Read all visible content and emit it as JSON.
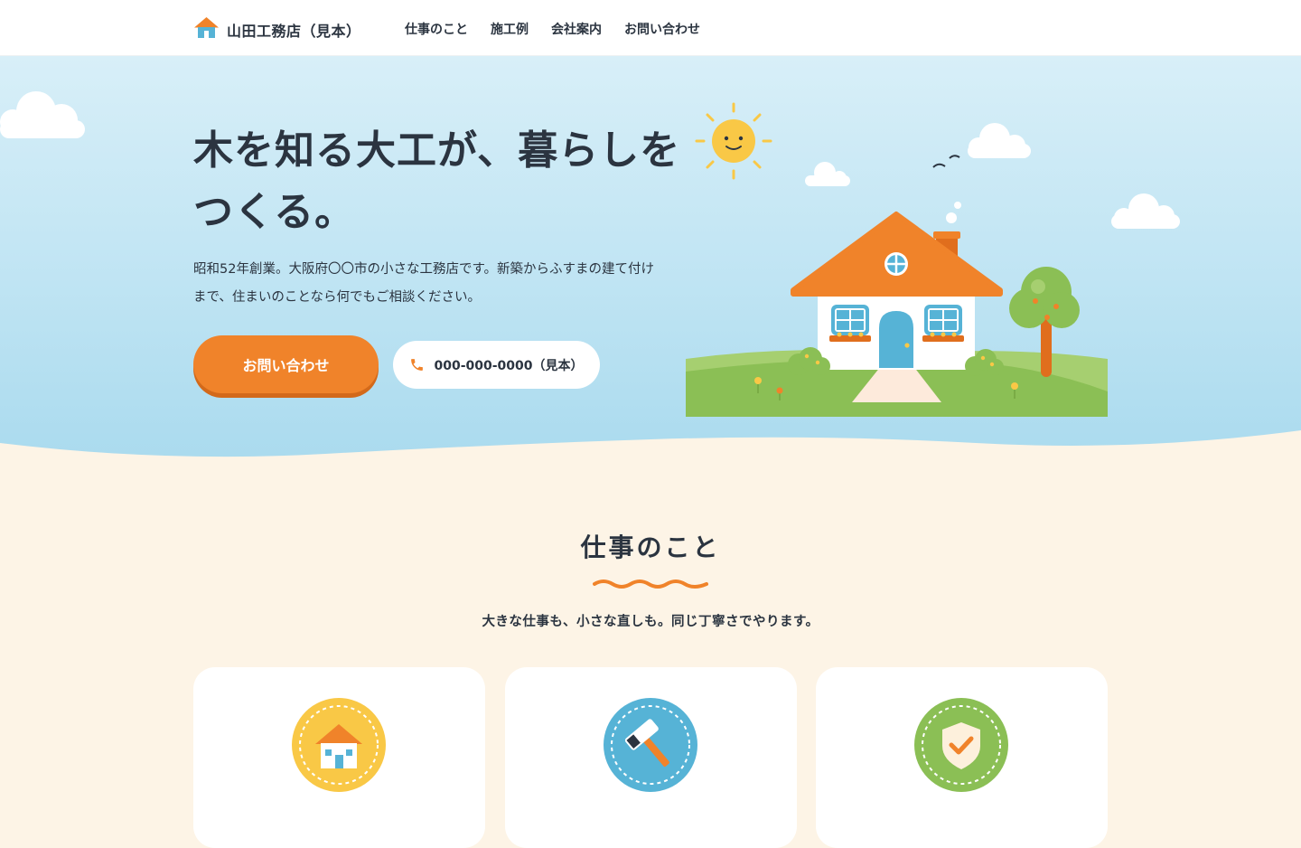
{
  "header": {
    "logo_text": "山田工務店（見本）",
    "logo_icon": "house-icon",
    "nav": [
      {
        "label": "仕事のこと"
      },
      {
        "label": "施工例"
      },
      {
        "label": "会社案内"
      },
      {
        "label": "お問い合わせ"
      }
    ]
  },
  "hero": {
    "title": "木を知る大工が、暮らしをつくる。",
    "description": "昭和52年創業。大阪府〇〇市の小さな工務店です。新築からふすまの建て付けまで、住まいのことなら何でもご相談ください。",
    "contact_button": "お問い合わせ",
    "phone_button": "000-000-0000（見本）",
    "phone_icon": "phone-icon"
  },
  "services": {
    "title": "仕事のこと",
    "lead": "大きな仕事も、小さな直しも。同じ丁寧さでやります。",
    "cards": [
      {
        "icon": "house-icon",
        "color": "#f9c846"
      },
      {
        "icon": "hammer-icon",
        "color": "#56b3d6"
      },
      {
        "icon": "shield-check-icon",
        "color": "#8bbf55"
      }
    ]
  },
  "colors": {
    "accent": "#f0832a",
    "text": "#2b3440",
    "sky": "#bfe4f3",
    "cream": "#fdf4e6"
  }
}
